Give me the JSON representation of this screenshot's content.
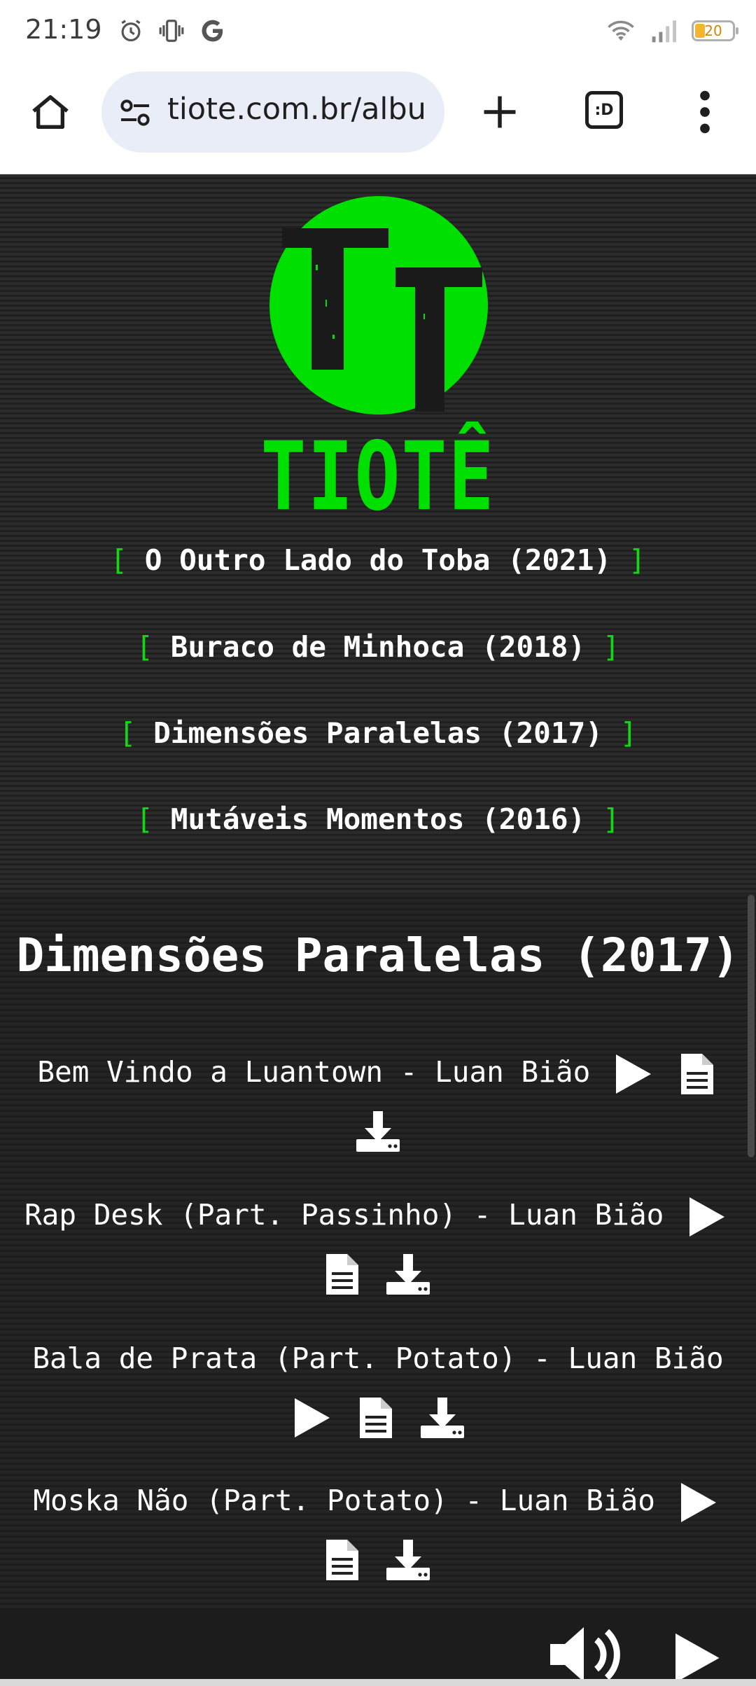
{
  "status_bar": {
    "time": "21:19",
    "battery_level": "20",
    "icons_left": [
      "alarm-icon",
      "vibrate-icon",
      "google-icon"
    ],
    "icons_right": [
      "wifi-icon",
      "signal-icon",
      "battery-icon"
    ]
  },
  "browser": {
    "url": "tiote.com.br/albu",
    "tab_count_label": ":D",
    "icons": [
      "home-icon",
      "site-settings-icon",
      "new-tab-icon",
      "tab-switcher-icon",
      "more-menu-icon"
    ]
  },
  "site": {
    "brand": "TIOTÊ",
    "accent_color": "#00e000",
    "bracket_open": "[",
    "bracket_close": "]",
    "albums": [
      {
        "label": "O Outro Lado do Toba (2021)"
      },
      {
        "label": "Buraco de Minhoca (2018)"
      },
      {
        "label": "Dimensões Paralelas (2017)"
      },
      {
        "label": "Mutáveis Momentos (2016)"
      }
    ]
  },
  "album": {
    "title": "Dimensões Paralelas (2017)",
    "tracks": [
      {
        "name": "Bem Vindo a Luantown - Luan Bião"
      },
      {
        "name": "Rap Desk (Part. Passinho) - Luan Bião"
      },
      {
        "name": "Bala de Prata (Part. Potato) - Luan Bião"
      },
      {
        "name": "Moska Não (Part. Potato) - Luan Bião"
      }
    ],
    "track_icons": [
      "play-icon",
      "lyrics-icon",
      "download-icon"
    ]
  }
}
